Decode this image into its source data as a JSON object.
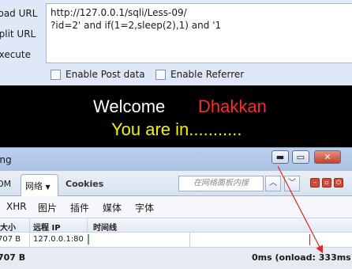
{
  "hackbar": {
    "sidebar": [
      {
        "label": "Load URL"
      },
      {
        "label": "Split URL"
      },
      {
        "label": "Execute"
      }
    ],
    "url_text": "http://127.0.0.1/sqli/Less-09/\n?id=2' and if(1=2,sleep(2),1) and '1",
    "options": [
      {
        "label": "Enable Post data",
        "checked": false
      },
      {
        "label": "Enable Referrer",
        "checked": false
      }
    ]
  },
  "page": {
    "welcome": "Welcome",
    "username": "Dhakkan",
    "message": "You are in...........",
    "colors": {
      "background": "#000000",
      "welcome": "#ffffff",
      "username": "#ff2a2a",
      "message": "#f2f200"
    }
  },
  "firebug": {
    "title": "ing",
    "window_buttons": [
      {
        "name": "minimize",
        "glyph": "▬"
      },
      {
        "name": "restore",
        "glyph": "▭"
      },
      {
        "name": "close",
        "glyph": "✕"
      }
    ],
    "tabs": {
      "dom_label": "OM",
      "net_label": "网络",
      "net_icon": "chevron-down-icon",
      "cookies_label": "Cookies"
    },
    "search_placeholder": "在网络面板内搜",
    "filters": [
      "XHR",
      "图片",
      "插件",
      "媒体",
      "字体"
    ],
    "columns": {
      "size": "大小",
      "remote_ip": "远程 IP",
      "timeline": "时间线"
    },
    "request_row": {
      "size": "707 B",
      "remote_ip": "127.0.0.1:80"
    },
    "summary": {
      "total_size": "707 B",
      "timing": "0ms (onload: 333ms)"
    }
  }
}
